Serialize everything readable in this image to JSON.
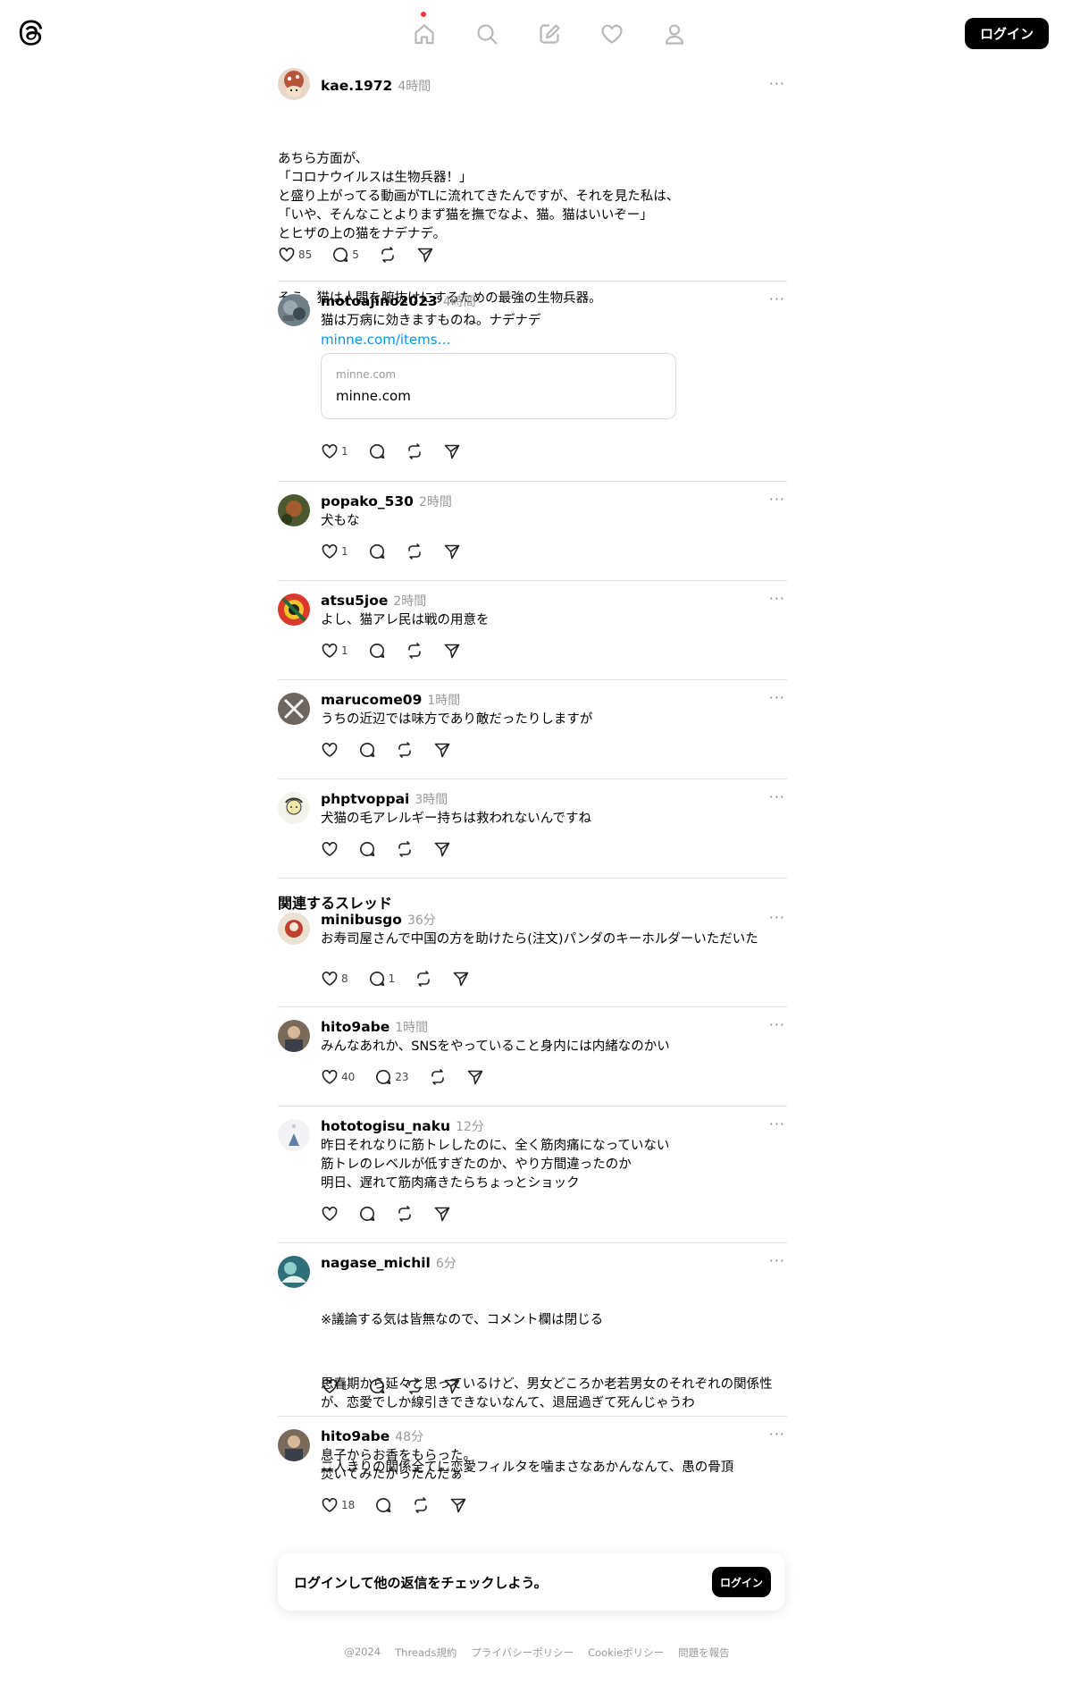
{
  "app": {
    "name": "Threads"
  },
  "header": {
    "login_label": "ログイン"
  },
  "main_post": {
    "username": "kae.1972",
    "time": "4時間",
    "paragraphs": [
      "あちら方面が、\n「コロナウイルスは生物兵器！」\nと盛り上がってる動画がTLに流れてきたんですが、それを見た私は、\n「いや、そんなことよりまず猫を撫でなよ、猫。猫はいいぞー」\nとヒザの上の猫をナデナデ。",
      "そう、猫は人間を腑抜けにするための最強の生物兵器。"
    ],
    "likes": "85",
    "replies": "5"
  },
  "replies": [
    {
      "username": "motoajino2023",
      "time": "4時間",
      "text": "猫は万病に効きますものね。ナデナデ",
      "link": "minne.com/items…",
      "card_host": "minne.com",
      "card_title": "minne.com",
      "likes": "1",
      "replies": ""
    },
    {
      "username": "popako_530",
      "time": "2時間",
      "text": "犬もな",
      "likes": "1",
      "replies": ""
    },
    {
      "username": "atsu5joe",
      "time": "2時間",
      "text": "よし、猫アレ民は戦の用意を",
      "likes": "1",
      "replies": ""
    },
    {
      "username": "marucome09",
      "time": "1時間",
      "text": "うちの近辺では味方であり敵だったりしますが",
      "likes": "",
      "replies": ""
    },
    {
      "username": "phptvoppai",
      "time": "3時間",
      "text": "犬猫の毛アレルギー持ちは救われないんですね",
      "likes": "",
      "replies": ""
    }
  ],
  "related_title": "関連するスレッド",
  "related": [
    {
      "username": "minibusgo",
      "time": "36分",
      "paragraphs": [
        "お寿司屋さんで中国の方を助けたら(注文)パンダのキーホルダーいただいた"
      ],
      "likes": "8",
      "replies": "1"
    },
    {
      "username": "hito9abe",
      "time": "1時間",
      "paragraphs": [
        "みんなあれか、SNSをやっていること身内には内緒なのかい"
      ],
      "likes": "40",
      "replies": "23"
    },
    {
      "username": "hototogisu_naku",
      "time": "12分",
      "paragraphs": [
        "昨日それなりに筋トレしたのに、全く筋肉痛になっていない\n筋トレのレベルが低すぎたのか、やり方間違ったのか\n明日、遅れて筋肉痛きたらちょっとショック"
      ],
      "likes": "",
      "replies": ""
    },
    {
      "username": "nagase_michil",
      "time": "6分",
      "paragraphs": [
        "※議論する気は皆無なので、コメント欄は閉じる",
        "思春期から延々と思っているけど、男女どころか老若男女のそれぞれの関係性が、恋愛でしか線引きできないなんて、退屈過ぎて死んじゃうわ",
        "二人きりの関係全てに恋愛フィルタを噛まさなあかんなんて、愚の骨頂"
      ],
      "likes": "1",
      "replies": ""
    },
    {
      "username": "hito9abe",
      "time": "48分",
      "paragraphs": [
        "息子からお香をもらった。\n焚いてみたかったんだぁ"
      ],
      "likes": "18",
      "replies": ""
    }
  ],
  "cta": {
    "text": "ログインして他の返信をチェックしよう。",
    "button": "ログイン"
  },
  "footer": {
    "links": [
      "@2024",
      "Threads規約",
      "プライバシーポリシー",
      "Cookieポリシー",
      "問題を報告"
    ]
  }
}
